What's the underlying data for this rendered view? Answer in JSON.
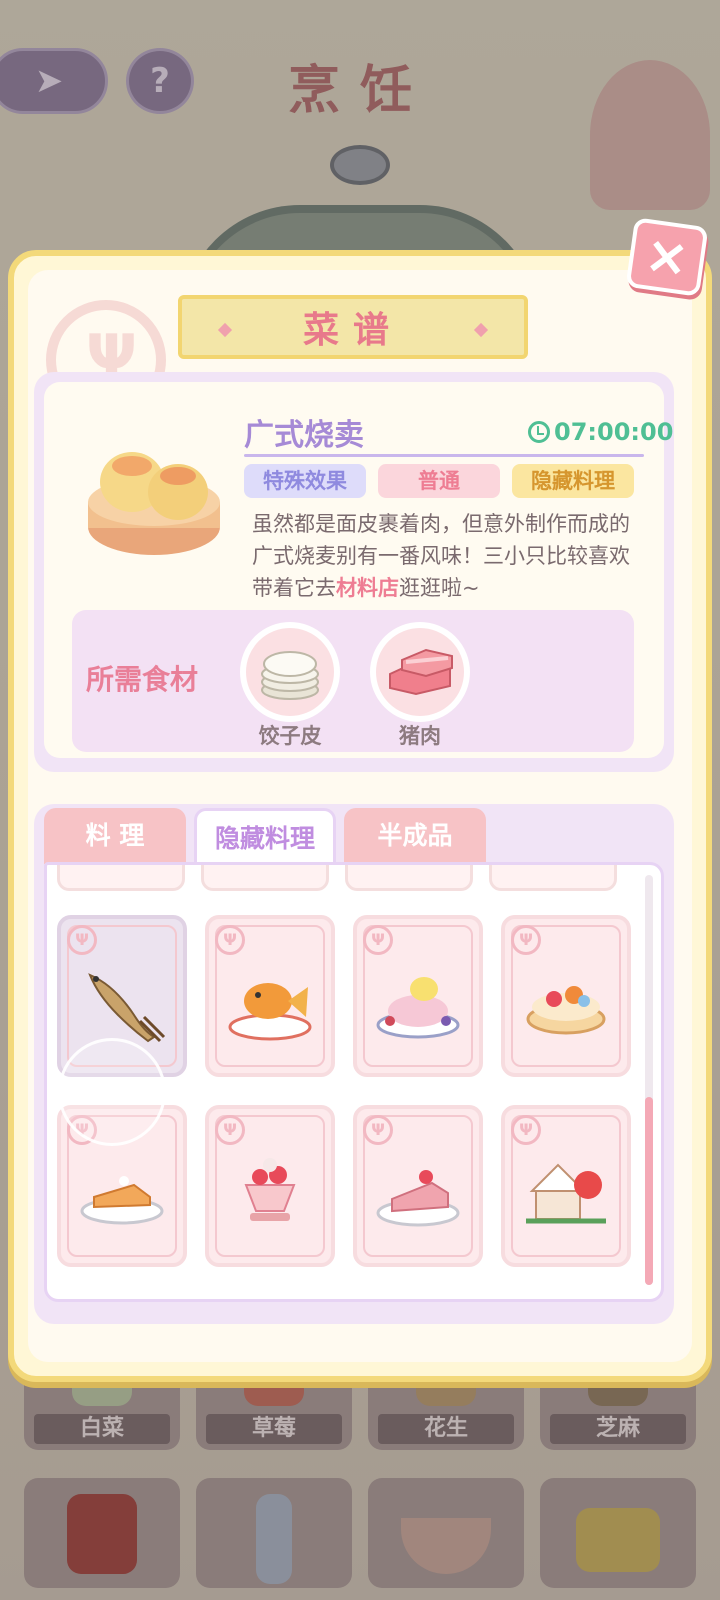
{
  "background": {
    "title": "烹饪",
    "ingredients_row": [
      "白菜",
      "草莓",
      "花生",
      "芝麻"
    ]
  },
  "dialog": {
    "title": "菜谱",
    "close_label": "×",
    "dish": {
      "name": "广式烧卖",
      "time": "07:00:00",
      "tags": [
        "特殊效果",
        "普通",
        "隐藏料理"
      ],
      "desc_before": "虽然都是面皮裹着肉，但意外制作而成的广式烧麦别有一番风味！三小只比较喜欢带着它去",
      "desc_highlight": "材料店",
      "desc_after": "逛逛啦~"
    },
    "ingredients": {
      "title": "所需食材",
      "items": [
        {
          "label": "饺子皮",
          "icon": "dumpling-wrapper-icon"
        },
        {
          "label": "猪肉",
          "icon": "pork-icon"
        }
      ]
    },
    "tabs": [
      "料 理",
      "隐藏料理",
      "半成品"
    ],
    "active_tab": 1,
    "recipes": [
      {
        "icon": "fish-dish-icon",
        "selected": true
      },
      {
        "icon": "goldfish-dish-icon",
        "selected": false
      },
      {
        "icon": "chick-pudding-icon",
        "selected": false
      },
      {
        "icon": "fruit-tart-icon",
        "selected": false
      },
      {
        "icon": "cake-slice-icon",
        "selected": false
      },
      {
        "icon": "strawberry-sundae-icon",
        "selected": false
      },
      {
        "icon": "strawberry-cake-icon",
        "selected": false
      },
      {
        "icon": "gingerbread-house-icon",
        "selected": false
      }
    ],
    "scroll_position": 0.55
  },
  "colors": {
    "accent_pink": "#ee7d93",
    "accent_purple": "#a68ad6",
    "timer_green": "#4fbf94",
    "frame_yellow": "#f3d97a"
  }
}
